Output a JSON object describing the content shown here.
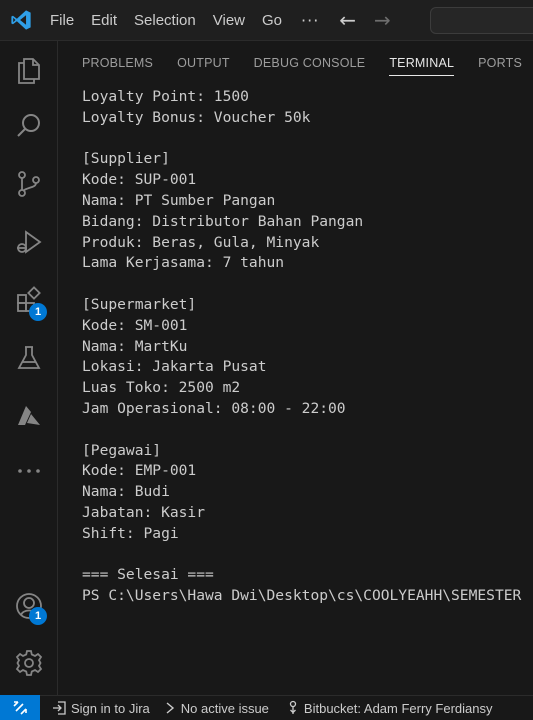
{
  "menu": {
    "items": [
      "File",
      "Edit",
      "Selection",
      "View",
      "Go"
    ],
    "more": "···"
  },
  "panel": {
    "tabs": [
      {
        "label": "PROBLEMS",
        "active": false
      },
      {
        "label": "OUTPUT",
        "active": false
      },
      {
        "label": "DEBUG CONSOLE",
        "active": false
      },
      {
        "label": "TERMINAL",
        "active": true
      },
      {
        "label": "PORTS",
        "active": false
      }
    ]
  },
  "activity": {
    "extensions_badge": "1",
    "accounts_badge": "1"
  },
  "terminal": {
    "lines": [
      "Loyalty Point: 1500",
      "Loyalty Bonus: Voucher 50k",
      "",
      "[Supplier]",
      "Kode: SUP-001",
      "Nama: PT Sumber Pangan",
      "Bidang: Distributor Bahan Pangan",
      "Produk: Beras, Gula, Minyak",
      "Lama Kerjasama: 7 tahun",
      "",
      "[Supermarket]",
      "Kode: SM-001",
      "Nama: MartKu",
      "Lokasi: Jakarta Pusat",
      "Luas Toko: 2500 m2",
      "Jam Operasional: 08:00 - 22:00",
      "",
      "[Pegawai]",
      "Kode: EMP-001",
      "Nama: Budi",
      "Jabatan: Kasir",
      "Shift: Pagi",
      "",
      "=== Selesai ===",
      "PS C:\\Users\\Hawa Dwi\\Desktop\\cs\\COOLYEAHH\\SEMESTER"
    ]
  },
  "statusbar": {
    "jira": "Sign in to Jira",
    "issue": "No active issue",
    "bitbucket": "Bitbucket: Adam Ferry Ferdiansy"
  },
  "colors": {
    "accent": "#0078d4",
    "background": "#181818"
  }
}
